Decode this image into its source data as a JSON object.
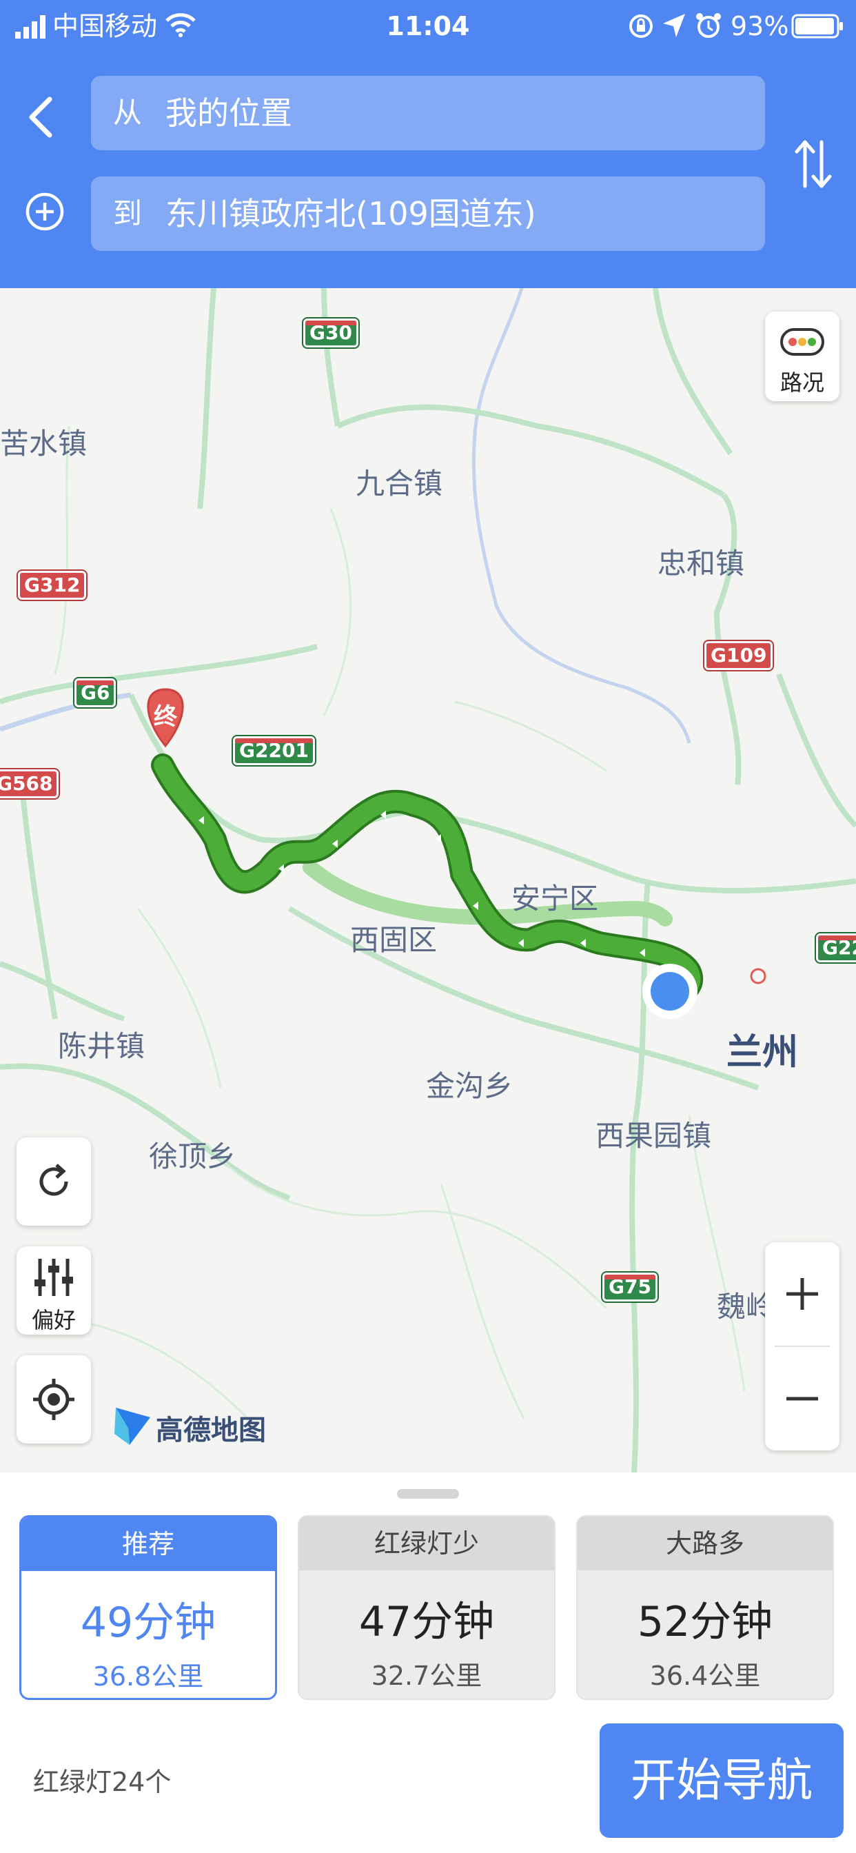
{
  "status_bar": {
    "carrier": "中国移动",
    "time": "11:04",
    "battery": "93%"
  },
  "header": {
    "from_prefix": "从",
    "from_value": "我的位置",
    "to_prefix": "到",
    "to_value": "东川镇政府北(109国道东)"
  },
  "map": {
    "places": [
      "苦水镇",
      "九合镇",
      "忠和镇",
      "西固区",
      "安宁区",
      "陈井镇",
      "金沟乡",
      "西果园镇",
      "徐顶乡",
      "魏岭"
    ],
    "city": "兰州",
    "shields": [
      "G30",
      "G312",
      "G6",
      "G2201",
      "G568",
      "G109",
      "G22",
      "G75"
    ],
    "end_marker": "终",
    "traffic_label": "路况",
    "preference_label": "偏好",
    "logo_text": "高德地图",
    "colors": {
      "route": "#3d9e2c",
      "alt_route": "#a9dca0",
      "accent": "#4f86f2"
    }
  },
  "routes": [
    {
      "tag": "推荐",
      "time": "49分钟",
      "distance": "36.8公里",
      "selected": true
    },
    {
      "tag": "红绿灯少",
      "time": "47分钟",
      "distance": "32.7公里",
      "selected": false
    },
    {
      "tag": "大路多",
      "time": "52分钟",
      "distance": "36.4公里",
      "selected": false
    }
  ],
  "traffic_lights": "红绿灯24个",
  "start_nav": "开始导航"
}
